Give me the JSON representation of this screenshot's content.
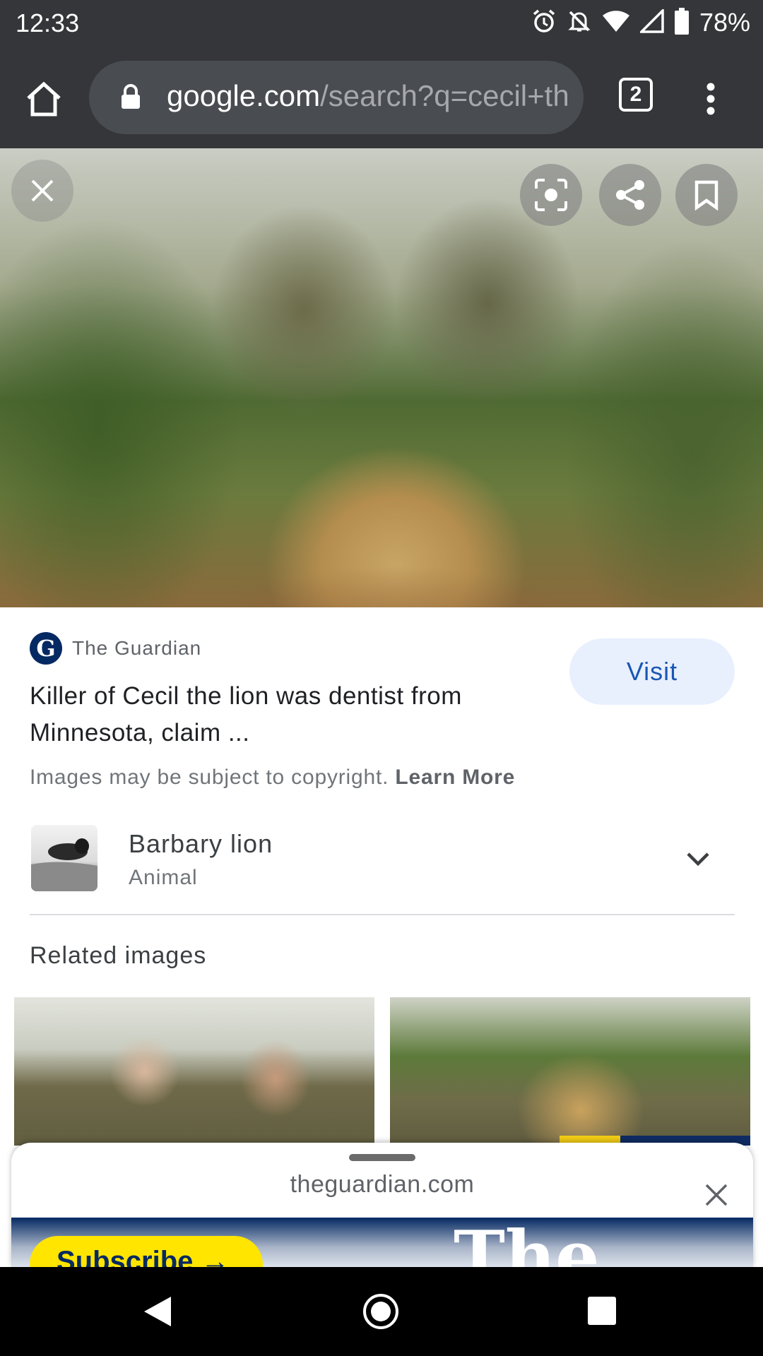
{
  "status_bar": {
    "time": "12:33",
    "battery": "78%",
    "icons": [
      "alarm-icon",
      "bell-off-icon",
      "wifi-icon",
      "signal-icon",
      "battery-icon"
    ]
  },
  "browser": {
    "url_domain": "google.com",
    "url_path": "/search?q=cecil+th",
    "tab_count": "2",
    "icons": [
      "home-icon",
      "lock-icon",
      "more-vert-icon"
    ]
  },
  "viewer": {
    "buttons": [
      "close-icon",
      "lens-icon",
      "share-icon",
      "bookmark-icon"
    ]
  },
  "result": {
    "source_name": "The Guardian",
    "source_logo_letter": "G",
    "title": "Killer of Cecil the lion was dentist from Minnesota, claim ...",
    "visit_label": "Visit",
    "copyright_text": "Images may be subject to copyright.",
    "learn_more": "Learn More"
  },
  "entity": {
    "name": "Barbary lion",
    "type": "Animal"
  },
  "related": {
    "heading": "Related images"
  },
  "sheet": {
    "domain": "theguardian.com",
    "subscribe_label": "Subscribe →",
    "logo_text": "The"
  },
  "colors": {
    "chrome_dark": "#343639",
    "omnibox": "#494c50",
    "visit_bg": "#e8f0fe",
    "visit_text": "#1a56b4",
    "guardian_blue": "#052962",
    "guardian_yellow": "#ffe500"
  }
}
